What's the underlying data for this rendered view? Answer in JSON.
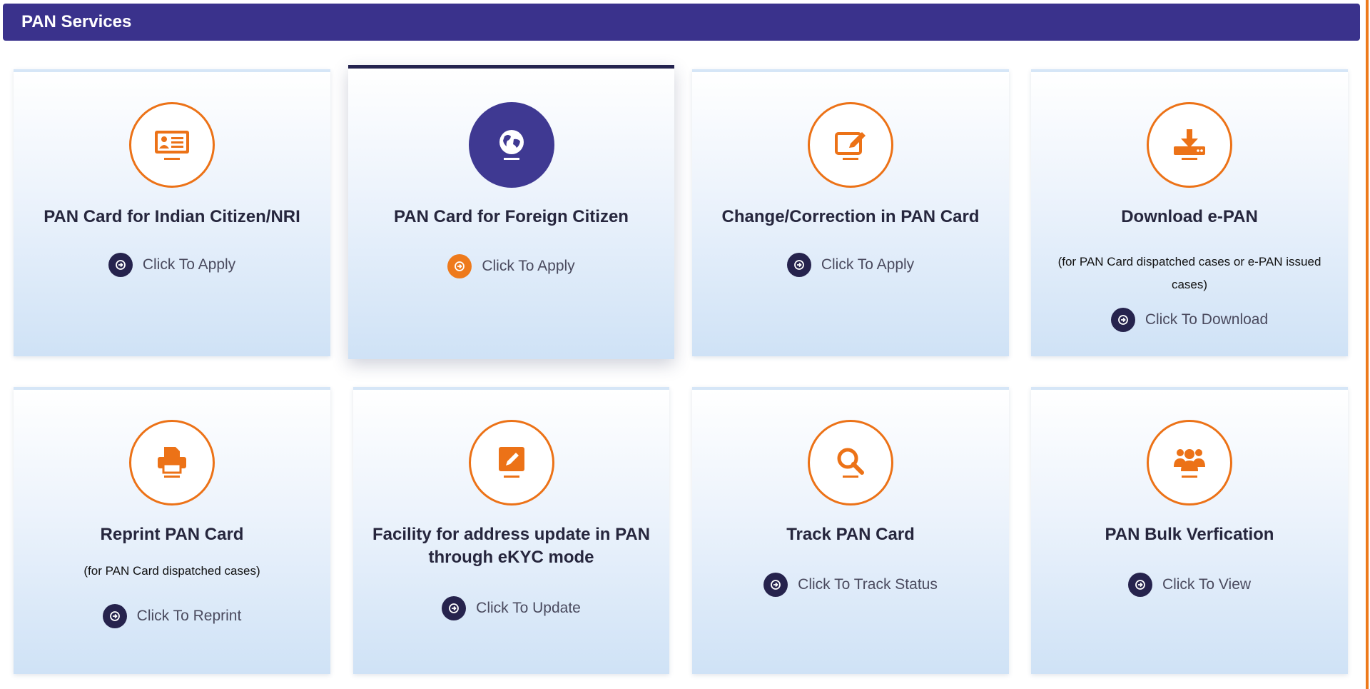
{
  "header": {
    "title": "PAN Services"
  },
  "cards": [
    {
      "title": "PAN Card for Indian Citizen/NRI",
      "note": "",
      "action": "Click To Apply",
      "icon": "id-card-icon"
    },
    {
      "title": "PAN Card for Foreign Citizen",
      "note": "",
      "action": "Click To Apply",
      "icon": "globe-icon"
    },
    {
      "title": "Change/Correction in PAN Card",
      "note": "",
      "action": "Click To Apply",
      "icon": "edit-icon"
    },
    {
      "title": "Download e-PAN",
      "note": "(for PAN Card dispatched cases or e-PAN issued cases)",
      "action": "Click To Download",
      "icon": "download-icon"
    },
    {
      "title": "Reprint PAN Card",
      "note": "(for PAN Card dispatched cases)",
      "action": "Click To Reprint",
      "icon": "printer-icon"
    },
    {
      "title": "Facility for address update in PAN through eKYC mode",
      "note": "",
      "action": "Click To Update",
      "icon": "pencil-square-icon"
    },
    {
      "title": "Track PAN Card",
      "note": "",
      "action": "Click To Track Status",
      "icon": "search-icon"
    },
    {
      "title": "PAN Bulk Verfication",
      "note": "",
      "action": "Click To View",
      "icon": "users-icon"
    }
  ],
  "colors": {
    "header_bg": "#3a328c",
    "accent_orange": "#ec7217",
    "active_icon_bg": "#3f3992",
    "action_icon_bg": "#26234d"
  }
}
